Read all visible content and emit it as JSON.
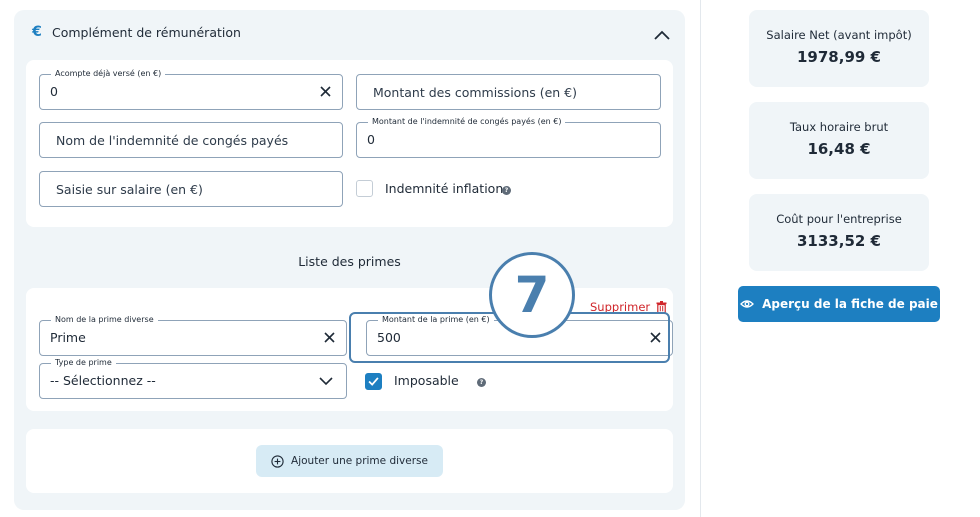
{
  "section": {
    "title": "Complément de rémunération",
    "icon": "euro-icon"
  },
  "fields": {
    "acompte": {
      "label": "Acompte déjà versé (en €)",
      "value": "0"
    },
    "commissions": {
      "placeholder": "Montant des commissions (en €)"
    },
    "conges_nom": {
      "placeholder": "Nom de l'indemnité de congés payés"
    },
    "conges_montant": {
      "label": "Montant de l'indemnité de congés payés (en €)",
      "value": "0"
    },
    "saisie": {
      "placeholder": "Saisie sur salaire (en €)"
    },
    "inflation": {
      "label": "Indemnité inflation",
      "checked": false
    }
  },
  "primes": {
    "title": "Liste des primes",
    "delete_label": "Supprimer",
    "nom": {
      "label": "Nom de la prime diverse",
      "value": "Prime"
    },
    "montant": {
      "label": "Montant de la prime (en €)",
      "value": "500"
    },
    "type": {
      "label": "Type de prime",
      "value": "-- Sélectionnez --"
    },
    "imposable": {
      "label": "Imposable",
      "checked": true
    },
    "add_label": "Ajouter une prime diverse"
  },
  "annotation": {
    "step": "7"
  },
  "summary": {
    "net": {
      "label": "Salaire Net (avant impôt)",
      "value": "1978,99 €"
    },
    "taux": {
      "label": "Taux horaire brut",
      "value": "16,48 €"
    },
    "cout": {
      "label": "Coût pour l'entreprise",
      "value": "3133,52 €"
    },
    "preview_label": "Aperçu de la fiche de paie"
  },
  "colors": {
    "accent": "#1d7fc1",
    "danger": "#d0262b",
    "panel_bg": "#f0f5f8",
    "annotation": "#4a7fae"
  }
}
